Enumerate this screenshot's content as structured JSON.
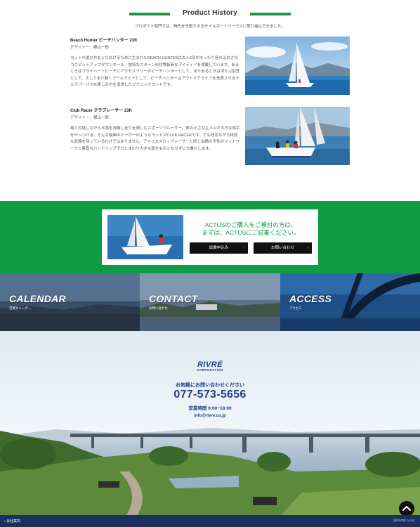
{
  "history": {
    "title": "Product History",
    "lead": "プロダクト部門では、時代を先取りするセイルボートワークスに取り組んできました。",
    "products": [
      {
        "name": "Beach Hunter ビーチハンター 23ft",
        "designer": "デザイナー：横山一郎",
        "desc": "ヨットの遊び方をより広げるために生まれたBEACH HUNTERは大人8名がゆったり座れる広さのコクピットアップダウンキール、独特なスターン形状等斬新なアイディアを満載しています。あるときはプライベートビーチにアクセスフリーのビーチハンターとして、またあるときは浮かぶ別荘として。そしてまた動くプールサイドとして。ビーチハンターはアウトドアライフを充実させるマルチパーパスな楽しみ方を追求したピクニックヨットです。",
        "image": "beach-hunter-sailboat-photo"
      },
      {
        "name": "Club Racer クラブレーサー 23ft",
        "designer": "デザイナー：横山一郎",
        "desc": "風と対話しながら五感を洗練し走りを楽しむスポーツクルーザー。体の小さな主人公が大きな相手をやっつける。そんな映画のヒーローのようなヨットがCLUB RACERです。でも残念ながら特別な武器を持っているわけではありません。アメリカズカップレーサーと同じ血筋の天性のフットワークと素直なハンドリングでひとまわり大きな艇をものともせずに大暴れします。",
        "image": "club-racer-sailboat-photo"
      }
    ]
  },
  "contact_banner": {
    "message_line1": "ACTUSのご購入をご検討の方は、",
    "message_line2": "まずは、ACTUSにご試乗ください。",
    "button_trial": "試乗申込み",
    "button_inquiry": "お問い合わせ",
    "button_arrow": "›",
    "color": "#0f9a44"
  },
  "panels": [
    {
      "title": "CALENDAR",
      "sub": "営業カレンダー"
    },
    {
      "title": "CONTACT",
      "sub": "お問い合わせ"
    },
    {
      "title": "ACCESS",
      "sub": "アクセス"
    }
  ],
  "footer": {
    "logo_main": "RIVRÉ",
    "logo_sub": "CORPORATION",
    "call": "お気軽にお問い合わせください",
    "tel": "077-573-5656",
    "hours": "営業時間 9:00~18:00",
    "email": "info@rivre.co.jp",
    "company_link": "会社案内",
    "copyright": "@RIVRE co.ltd",
    "accent": "#1e3f8a"
  },
  "totop_icon": "chevron-up-icon"
}
